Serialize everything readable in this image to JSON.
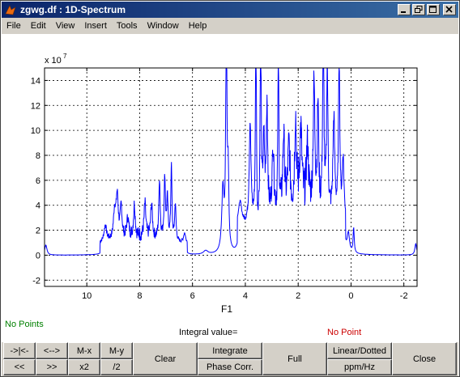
{
  "window": {
    "title": "zgwg.df : 1D-Spectrum",
    "icon": "matlab-logo-icon",
    "controls": [
      "minimize-icon",
      "restore-icon",
      "maximize-icon",
      "close-icon"
    ]
  },
  "menu": [
    "File",
    "Edit",
    "View",
    "Insert",
    "Tools",
    "Window",
    "Help"
  ],
  "plot": {
    "exponent_base": "x 10",
    "exponent_power": "7",
    "xlabel": "F1",
    "y_ticks": [
      "-2",
      "0",
      "2",
      "4",
      "6",
      "8",
      "10",
      "12",
      "14"
    ],
    "x_ticks": [
      "10",
      "8",
      "6",
      "4",
      "2",
      "0",
      "-2"
    ],
    "ylim": [
      -2.5,
      15
    ],
    "xlim": [
      11.6,
      -2.5
    ],
    "grid": "dotted",
    "line_color": "#0000ff"
  },
  "status": {
    "left": "No Points",
    "left_color": "#008000",
    "integral_label": "Integral value=",
    "right": "No Point",
    "right_color": "#cc0000"
  },
  "buttons": {
    "shift_right": "->|<-",
    "expand": "<-->",
    "m_x": "M-x",
    "m_y": "M-y",
    "shift_left": "<<",
    "shift_right2": ">>",
    "x2": "x2",
    "half": "/2",
    "clear": "Clear",
    "integrate": "Integrate",
    "phase_corr": "Phase Corr.",
    "full": "Full",
    "linear_dotted": "Linear/Dotted",
    "ppm_hz": "ppm/Hz",
    "close": "Close"
  }
}
